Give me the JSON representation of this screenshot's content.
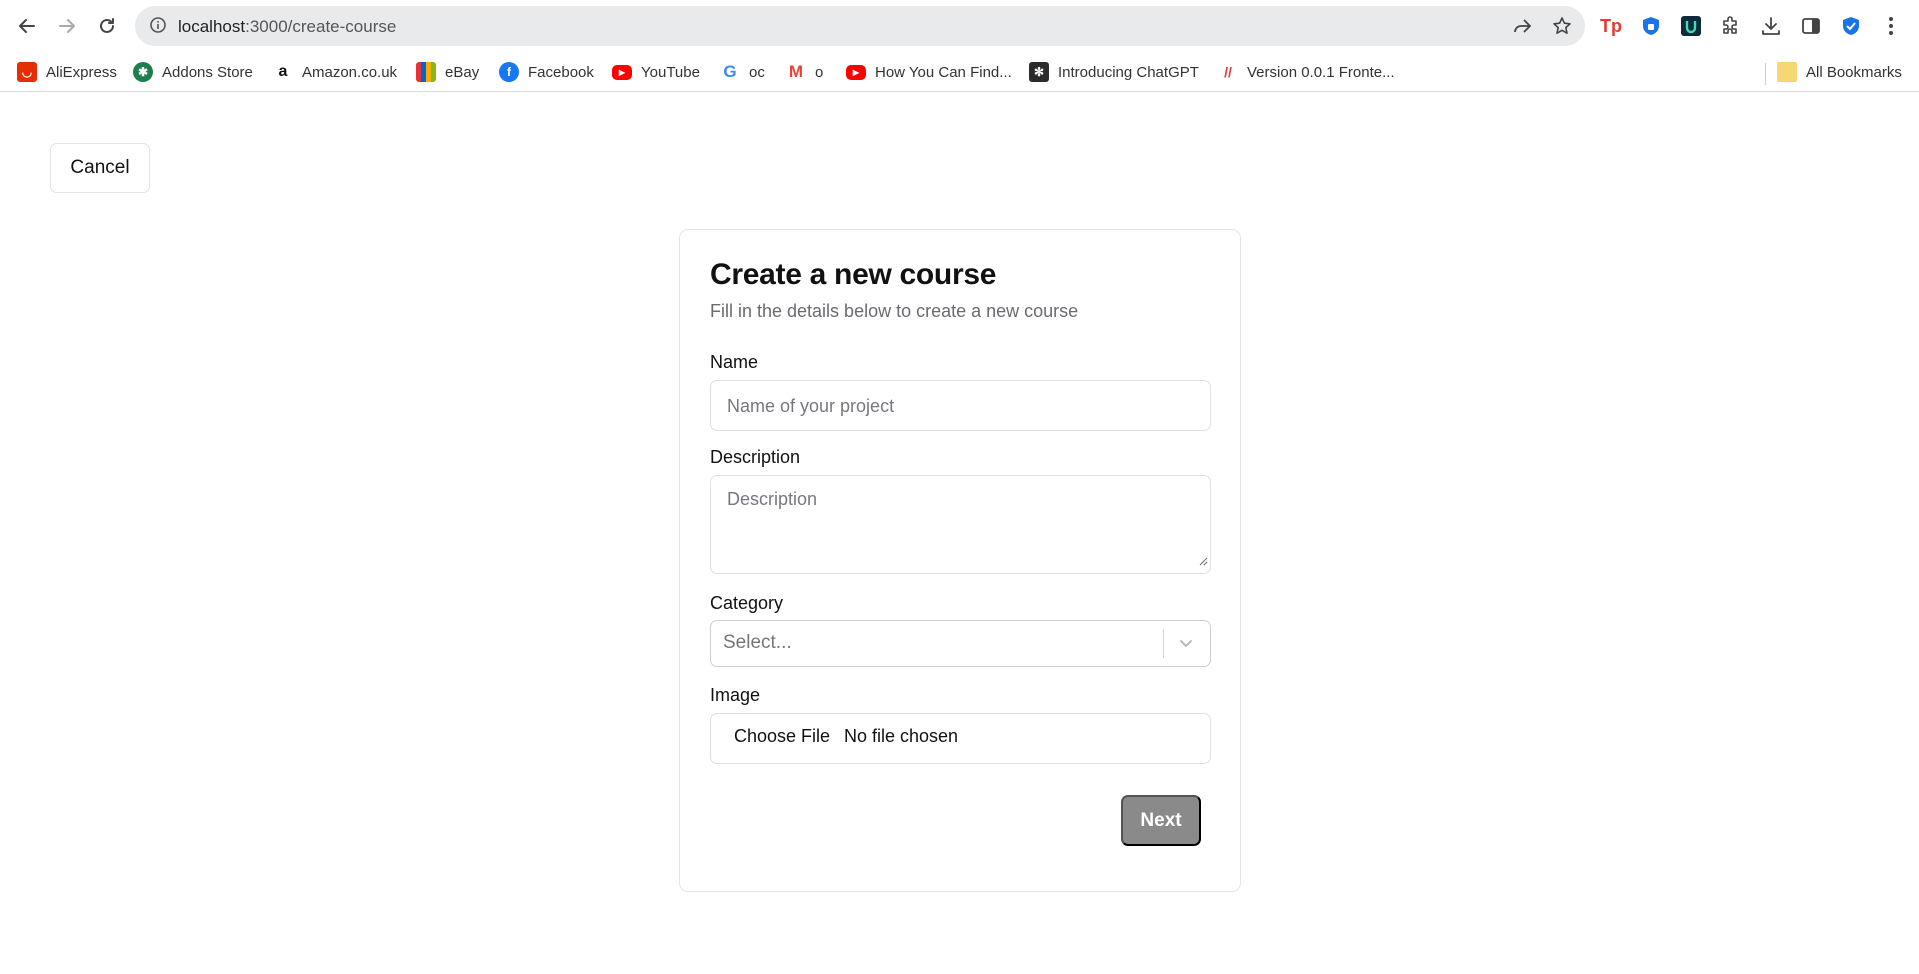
{
  "browser": {
    "url_host": "localhost",
    "url_path": ":3000/create-course",
    "bookmarks": [
      {
        "label": "AliExpress"
      },
      {
        "label": "Addons Store"
      },
      {
        "label": "Amazon.co.uk"
      },
      {
        "label": "eBay"
      },
      {
        "label": "Facebook"
      },
      {
        "label": "YouTube"
      },
      {
        "label": "oc"
      },
      {
        "label": "o"
      },
      {
        "label": "How You Can Find..."
      },
      {
        "label": "Introducing ChatGPT"
      },
      {
        "label": "Version 0.0.1 Fronte..."
      }
    ],
    "all_bookmarks": "All Bookmarks"
  },
  "page": {
    "cancel_label": "Cancel",
    "title": "Create a new course",
    "subtitle": "Fill in the details below to create a new course",
    "name": {
      "label": "Name",
      "placeholder": "Name of your project"
    },
    "description": {
      "label": "Description",
      "placeholder": "Description"
    },
    "category": {
      "label": "Category",
      "placeholder": "Select..."
    },
    "image": {
      "label": "Image",
      "button": "Choose File",
      "status": "No file chosen"
    },
    "next_label": "Next"
  },
  "colors": {
    "next_button_bg": "#8a8a8a",
    "border": "#e4e4e7",
    "muted_text": "#6b6b70"
  }
}
